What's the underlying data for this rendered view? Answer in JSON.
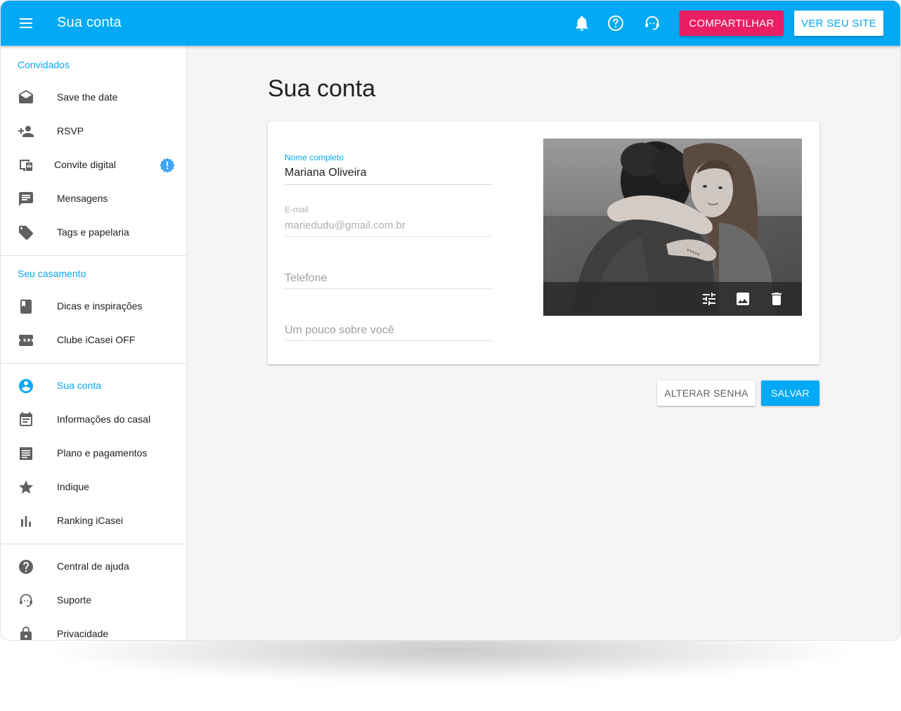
{
  "colors": {
    "primary": "#03a9f4",
    "accent": "#e91e63",
    "text": "#212121",
    "icon": "#616161"
  },
  "appbar": {
    "title": "Sua conta",
    "share_label": "COMPARTILHAR",
    "site_label": "VER SEU SITE",
    "icons": [
      "menu-icon",
      "bell-icon",
      "help-icon",
      "support-icon"
    ]
  },
  "sidebar": {
    "sections": [
      {
        "title": "Convidados"
      },
      {
        "title": "Seu casamento"
      }
    ],
    "items": [
      {
        "label": "Save the date",
        "icon": "envelope-open-icon"
      },
      {
        "label": "RSVP",
        "icon": "person-add-icon"
      },
      {
        "label": "Convite digital",
        "icon": "digital-invite-icon",
        "badge": "alert-badge-icon"
      },
      {
        "label": "Mensagens",
        "icon": "message-icon"
      },
      {
        "label": "Tags e papelaria",
        "icon": "tag-icon"
      },
      {
        "label": "Dicas e inspirações",
        "icon": "book-icon"
      },
      {
        "label": "Clube iCasei OFF",
        "icon": "ticket-star-icon"
      },
      {
        "label": "Sua conta",
        "icon": "account-circle-icon",
        "active": true
      },
      {
        "label": "Informações do casal",
        "icon": "event-note-icon"
      },
      {
        "label": "Plano e pagamentos",
        "icon": "receipt-icon"
      },
      {
        "label": "Indique",
        "icon": "star-icon"
      },
      {
        "label": "Ranking iCasei",
        "icon": "bar-chart-icon"
      },
      {
        "label": "Central de ajuda",
        "icon": "help-circle-icon"
      },
      {
        "label": "Suporte",
        "icon": "support-agent-icon"
      },
      {
        "label": "Privacidade",
        "icon": "lock-icon"
      }
    ]
  },
  "main": {
    "title": "Sua conta",
    "form": {
      "name_label": "Nome completo",
      "name_value": "Mariana Oliveira",
      "email_label": "E-mail",
      "email_value": "mariedudu@gmail.com.br",
      "phone_placeholder": "Telefone",
      "about_placeholder": "Um pouco sobre você"
    },
    "photo_tools": [
      "tune-icon",
      "image-icon",
      "delete-icon"
    ],
    "change_password_label": "ALTERAR SENHA",
    "save_label": "SALVAR"
  }
}
